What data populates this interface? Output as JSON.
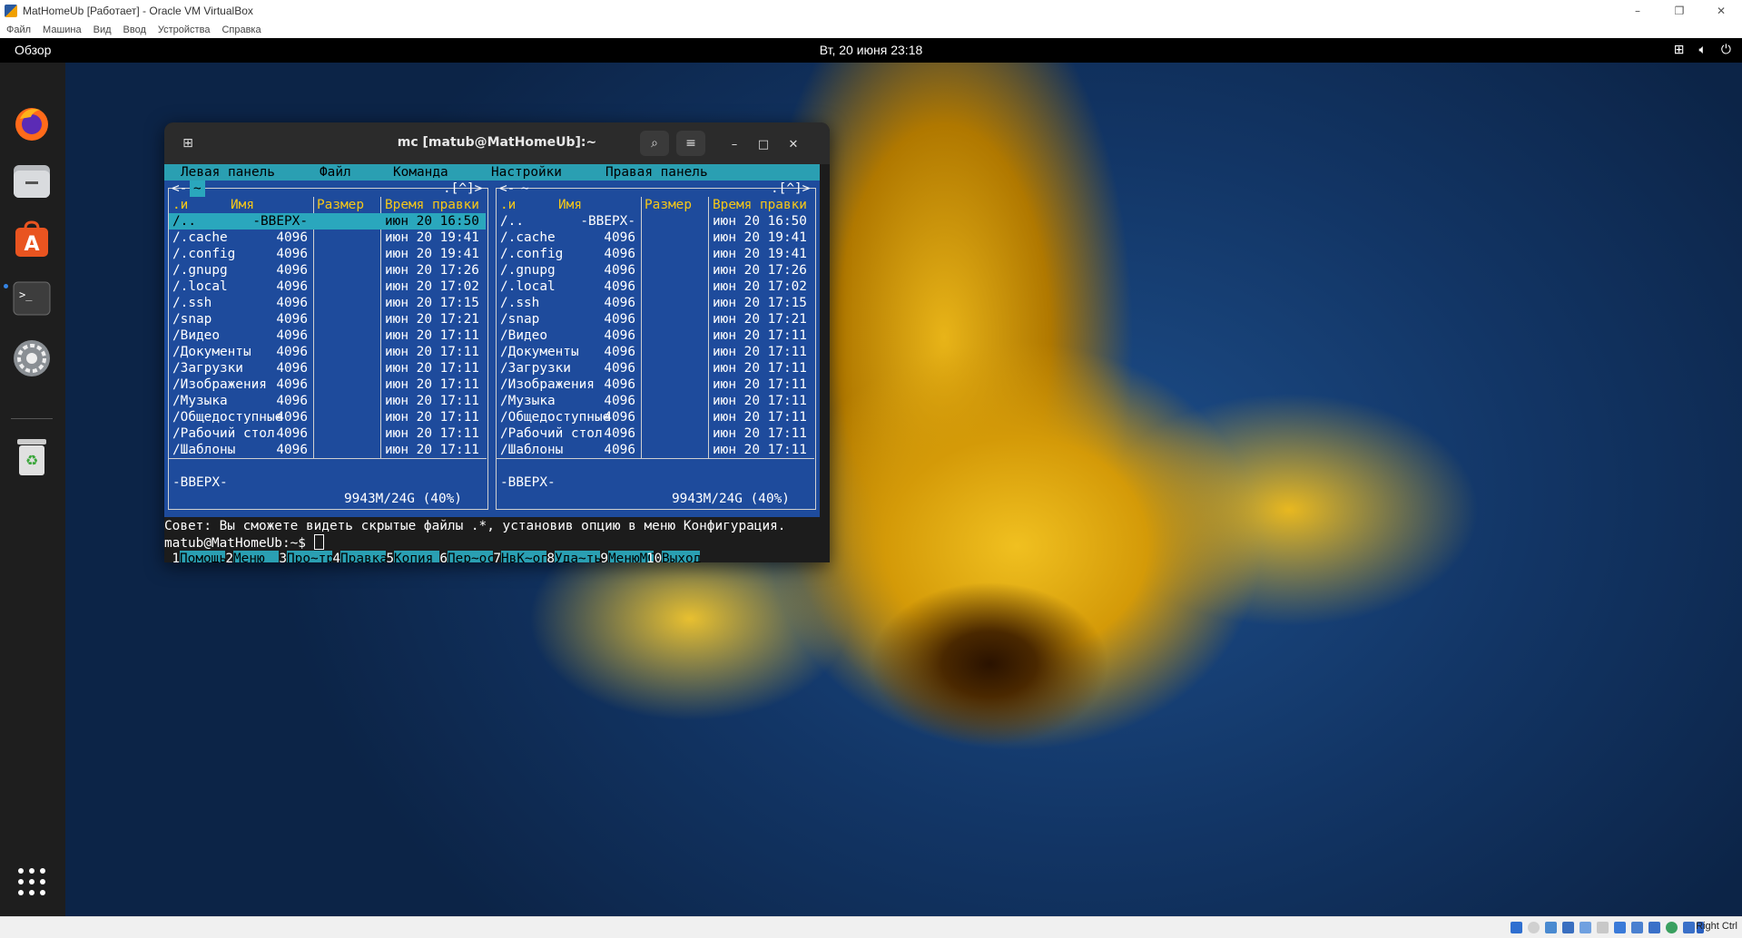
{
  "vbox": {
    "title": "MatHomeUb [Работает] - Oracle VM VirtualBox",
    "menu": [
      "Файл",
      "Машина",
      "Вид",
      "Ввод",
      "Устройства",
      "Справка"
    ],
    "window_buttons": {
      "minimize": "–",
      "maximize": "❐",
      "close": "✕"
    },
    "host_key": "Right Ctrl",
    "status_icons": [
      "harddisk-icon",
      "optical-icon",
      "audio-icon",
      "network-icon",
      "usb-icon",
      "shared-folder-icon",
      "display-icon",
      "recording-icon",
      "video-capture-icon",
      "mouse-integration-icon",
      "cpu-icon",
      "keyboard-icon"
    ]
  },
  "topbar": {
    "overview": "Обзор",
    "clock": "Вт, 20 июня  23:18",
    "tray_icons": [
      "network-icon",
      "volume-icon",
      "power-icon"
    ]
  },
  "dock": {
    "items": [
      "firefox-icon",
      "files-icon",
      "app-center-icon",
      "terminal-icon",
      "settings-icon",
      "trash-icon",
      "show-apps-icon"
    ]
  },
  "terminal": {
    "title": "mc [matub@MatHomeUb]:~",
    "new_tab": "⊞",
    "search": "⌕",
    "menu": "≡",
    "minimize": "–",
    "maximize": "□",
    "close": "✕"
  },
  "mc": {
    "menubar": [
      "Левая панель",
      "Файл",
      "Команда",
      "Настройки",
      "Правая панель"
    ],
    "left_panel": {
      "path": "~",
      "corner": ".[^]>",
      "headers": {
        "name_sort": ".и",
        "name": "Имя",
        "size": "Размер",
        "mtime": "Время правки"
      },
      "rows": [
        {
          "name": "/..",
          "size": "-ВВЕРХ-",
          "mtime": "июн 20 16:50"
        },
        {
          "name": "/.cache",
          "size": "4096",
          "mtime": "июн 20 19:41"
        },
        {
          "name": "/.config",
          "size": "4096",
          "mtime": "июн 20 19:41"
        },
        {
          "name": "/.gnupg",
          "size": "4096",
          "mtime": "июн 20 17:26"
        },
        {
          "name": "/.local",
          "size": "4096",
          "mtime": "июн 20 17:02"
        },
        {
          "name": "/.ssh",
          "size": "4096",
          "mtime": "июн 20 17:15"
        },
        {
          "name": "/snap",
          "size": "4096",
          "mtime": "июн 20 17:21"
        },
        {
          "name": "/Видео",
          "size": "4096",
          "mtime": "июн 20 17:11"
        },
        {
          "name": "/Документы",
          "size": "4096",
          "mtime": "июн 20 17:11"
        },
        {
          "name": "/Загрузки",
          "size": "4096",
          "mtime": "июн 20 17:11"
        },
        {
          "name": "/Изображения",
          "size": "4096",
          "mtime": "июн 20 17:11"
        },
        {
          "name": "/Музыка",
          "size": "4096",
          "mtime": "июн 20 17:11"
        },
        {
          "name": "/Общедоступные",
          "size": "4096",
          "mtime": "июн 20 17:11"
        },
        {
          "name": "/Рабочий стол",
          "size": "4096",
          "mtime": "июн 20 17:11"
        },
        {
          "name": "/Шаблоны",
          "size": "4096",
          "mtime": "июн 20 17:11"
        }
      ],
      "status": "-ВВЕРХ-",
      "disk": "9943M/24G (40%)"
    },
    "right_panel": {
      "path": "~",
      "corner": ".[^]>",
      "headers": {
        "name_sort": ".и",
        "name": "Имя",
        "size": "Размер",
        "mtime": "Время правки"
      },
      "rows": [
        {
          "name": "/..",
          "size": "-ВВЕРХ-",
          "mtime": "июн 20 16:50"
        },
        {
          "name": "/.cache",
          "size": "4096",
          "mtime": "июн 20 19:41"
        },
        {
          "name": "/.config",
          "size": "4096",
          "mtime": "июн 20 19:41"
        },
        {
          "name": "/.gnupg",
          "size": "4096",
          "mtime": "июн 20 17:26"
        },
        {
          "name": "/.local",
          "size": "4096",
          "mtime": "июн 20 17:02"
        },
        {
          "name": "/.ssh",
          "size": "4096",
          "mtime": "июн 20 17:15"
        },
        {
          "name": "/snap",
          "size": "4096",
          "mtime": "июн 20 17:21"
        },
        {
          "name": "/Видео",
          "size": "4096",
          "mtime": "июн 20 17:11"
        },
        {
          "name": "/Документы",
          "size": "4096",
          "mtime": "июн 20 17:11"
        },
        {
          "name": "/Загрузки",
          "size": "4096",
          "mtime": "июн 20 17:11"
        },
        {
          "name": "/Изображения",
          "size": "4096",
          "mtime": "июн 20 17:11"
        },
        {
          "name": "/Музыка",
          "size": "4096",
          "mtime": "июн 20 17:11"
        },
        {
          "name": "/Общедоступные",
          "size": "4096",
          "mtime": "июн 20 17:11"
        },
        {
          "name": "/Рабочий стол",
          "size": "4096",
          "mtime": "июн 20 17:11"
        },
        {
          "name": "/Шаблоны",
          "size": "4096",
          "mtime": "июн 20 17:11"
        }
      ],
      "status": "-ВВЕРХ-",
      "disk": "9943M/24G (40%)"
    },
    "hint": "Совет: Вы сможете видеть скрытые файлы .*, установив опцию в меню Конфигурация.",
    "prompt": "matub@MatHomeUb:~$ ",
    "fkeys": [
      {
        "num": "1",
        "label": "Помощь"
      },
      {
        "num": "2",
        "label": "Меню"
      },
      {
        "num": "3",
        "label": "Про~тр"
      },
      {
        "num": "4",
        "label": "Правка"
      },
      {
        "num": "5",
        "label": "Копия"
      },
      {
        "num": "6",
        "label": "Пер~ос"
      },
      {
        "num": "7",
        "label": "НвК~ог"
      },
      {
        "num": "8",
        "label": "Уда~ть"
      },
      {
        "num": "9",
        "label": "МенюMC"
      },
      {
        "num": "10",
        "label": "Выход"
      }
    ]
  },
  "colors": {
    "mc_panel_bg": "#1e4b9c",
    "mc_header": "#f7c818",
    "mc_cyan": "#2a9fb2",
    "dock_bg": "#1e1e1e",
    "topbar_bg": "#000000"
  }
}
